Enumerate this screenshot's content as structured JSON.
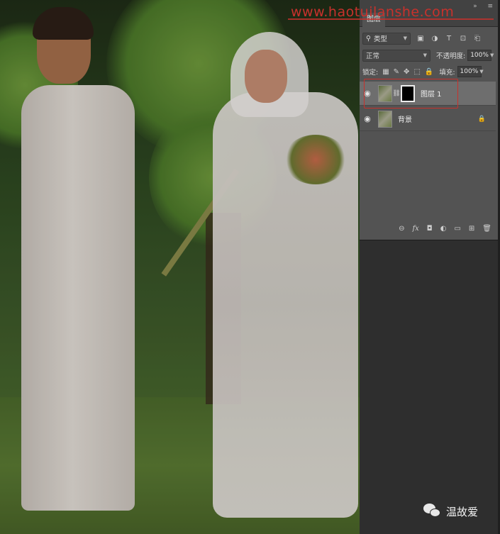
{
  "watermark": {
    "text": "www.haotuilanshe.com",
    "color": "#c8312c"
  },
  "panel": {
    "tab_label": "图层",
    "top_icons": "»  ≡",
    "filter": {
      "label": "类型",
      "icons": [
        "image-filter-icon",
        "adjustment-filter-icon",
        "type-filter-icon",
        "shape-filter-icon",
        "smart-object-filter-icon"
      ],
      "icon_glyphs": [
        "▣",
        "◑",
        "T",
        "⊡",
        "⎗"
      ]
    },
    "blend_mode": "正常",
    "opacity_label": "不透明度:",
    "opacity_value": "100%",
    "lock_label": "锁定:",
    "lock_icon_glyphs": [
      "▦",
      "✎",
      "✥",
      "⬚",
      "🔒"
    ],
    "fill_label": "填充:",
    "fill_value": "100%",
    "layers": [
      {
        "name": "图层 1",
        "visible": true,
        "has_mask": true,
        "selected": true
      },
      {
        "name": "背景",
        "visible": true,
        "has_mask": false,
        "locked": true
      }
    ],
    "footer_icons": [
      "link-layers-icon",
      "fx-icon",
      "add-mask-icon",
      "adjustment-layer-icon",
      "group-icon",
      "new-layer-icon",
      "delete-icon"
    ],
    "footer_glyphs": [
      "⊖",
      "fx",
      "◘",
      "◐",
      "▭",
      "⊞",
      "🗑"
    ]
  },
  "wechat": {
    "name": "温故爱"
  },
  "colors": {
    "highlight": "#c8312c",
    "panel_bg": "#535353",
    "selected_row": "#6e6e6e"
  }
}
